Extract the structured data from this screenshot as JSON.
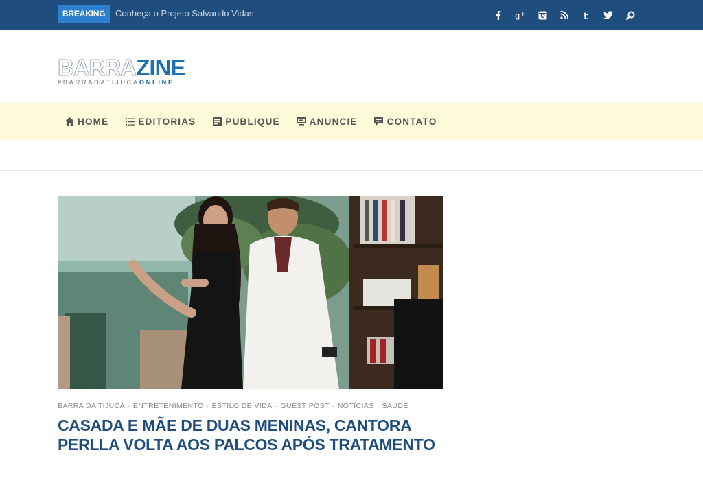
{
  "topbar": {
    "breaking_label": "BREAKING",
    "ticker_text": "Conheça o Projeto Salvando Vidas",
    "social_icons": [
      "facebook-icon",
      "google-plus-icon",
      "instagram-icon",
      "rss-icon",
      "tumblr-icon",
      "twitter-icon",
      "search-icon"
    ],
    "bg_color": "#1f4e7e",
    "badge_color": "#2d7fcf"
  },
  "logo": {
    "part1": "BARRA",
    "part2": "ZINE",
    "tagline_a": "#BARRADATIJUCA",
    "tagline_b": "ONLINE"
  },
  "nav": {
    "bg_color": "#fdfbd9",
    "items": [
      {
        "label": "HOME",
        "icon": "home-icon"
      },
      {
        "label": "EDITORIAS",
        "icon": "list-icon"
      },
      {
        "label": "PUBLIQUE",
        "icon": "document-icon"
      },
      {
        "label": "ANUNCIE",
        "icon": "billboard-icon"
      },
      {
        "label": "CONTATO",
        "icon": "speech-bubble-icon"
      }
    ]
  },
  "article": {
    "categories": [
      "BARRA DA TIJUCA",
      "ENTRETENIMENTO",
      "ESTILO DE VIDA",
      "GUEST POST",
      "NOTÍCIAS",
      "SAÚDE"
    ],
    "headline_line1": "CASADA E MÃE DE DUAS MENINAS, CANTORA",
    "headline_line2": "PERLLA VOLTA AOS PALCOS APÓS TRATAMENTO",
    "headline_color": "#1f4e7e"
  }
}
